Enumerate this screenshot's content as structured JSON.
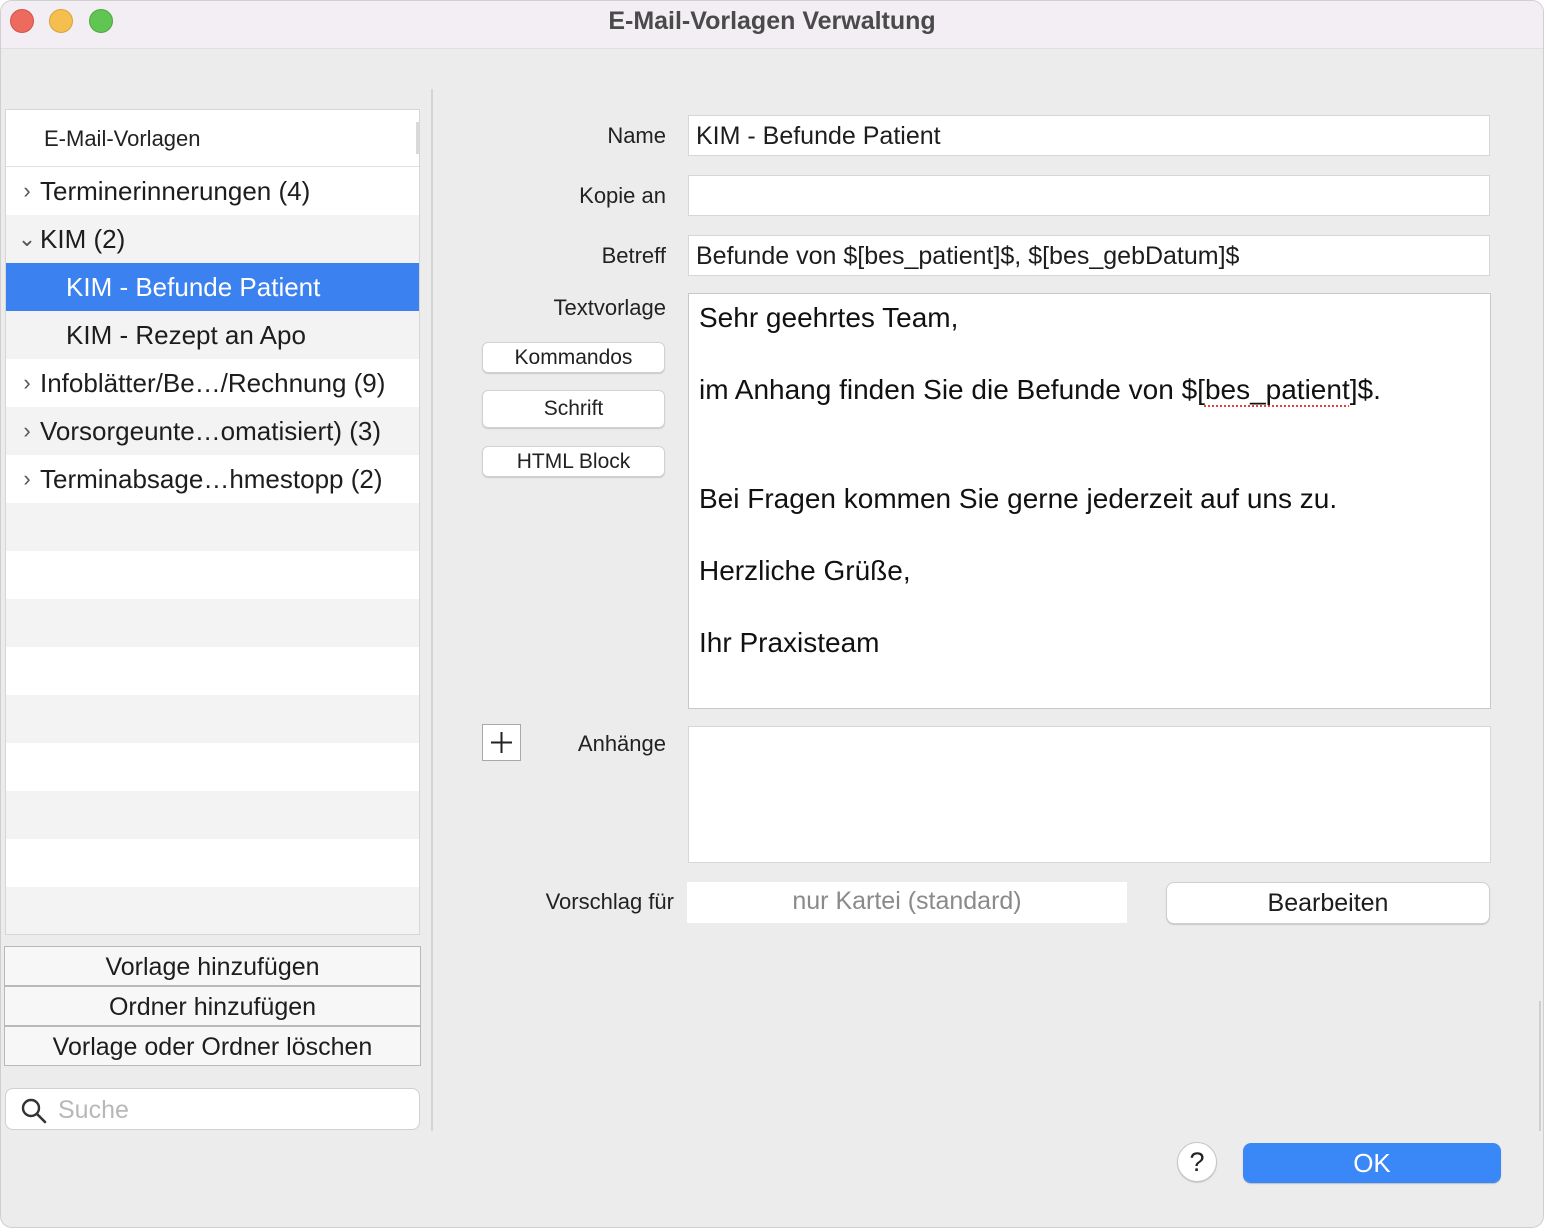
{
  "window": {
    "title": "E-Mail-Vorlagen Verwaltung"
  },
  "tree": {
    "header": "E-Mail-Vorlagen",
    "items": [
      {
        "label": "Terminerinnerungen (4)",
        "expanded": false,
        "level": 0
      },
      {
        "label": "KIM (2)",
        "expanded": true,
        "level": 0
      },
      {
        "label": "KIM - Befunde Patient",
        "level": 1,
        "selected": true
      },
      {
        "label": "KIM - Rezept an Apo",
        "level": 1
      },
      {
        "label": "Infoblätter/Be…/Rechnung (9)",
        "expanded": false,
        "level": 0
      },
      {
        "label": "Vorsorgeunte…omatisiert) (3)",
        "expanded": false,
        "level": 0
      },
      {
        "label": "Terminabsage…hmestopp (2)",
        "expanded": false,
        "level": 0
      }
    ]
  },
  "buttons": {
    "add_template": "Vorlage hinzufügen",
    "add_folder": "Ordner hinzufügen",
    "delete": "Vorlage oder Ordner löschen",
    "commands": "Kommandos",
    "font": "Schrift",
    "html_block": "HTML Block",
    "edit": "Bearbeiten",
    "help": "?",
    "ok": "OK"
  },
  "search": {
    "placeholder": "Suche"
  },
  "form": {
    "name_label": "Name",
    "name_value": "KIM - Befunde Patient",
    "cc_label": "Kopie an",
    "cc_value": "",
    "subject_label": "Betreff",
    "subject_value": "Befunde von $[bes_patient]$, $[bes_gebDatum]$",
    "body_label": "Textvorlage",
    "body": {
      "line1": "Sehr geehrtes Team,",
      "line2_pre": "im Anhang finden Sie die Befunde von $[",
      "line2_spell": "bes_patient",
      "line2_post": "]$.",
      "line3": "Bei Fragen kommen Sie gerne jederzeit auf uns zu.",
      "line4": "Herzliche Grüße,",
      "line5": "Ihr Praxisteam"
    },
    "attachments_label": "Anhänge",
    "suggest_label": "Vorschlag für",
    "suggest_value": "nur Kartei (standard)"
  },
  "colors": {
    "selection": "#3b82f0",
    "ok_button": "#3a87f7"
  }
}
